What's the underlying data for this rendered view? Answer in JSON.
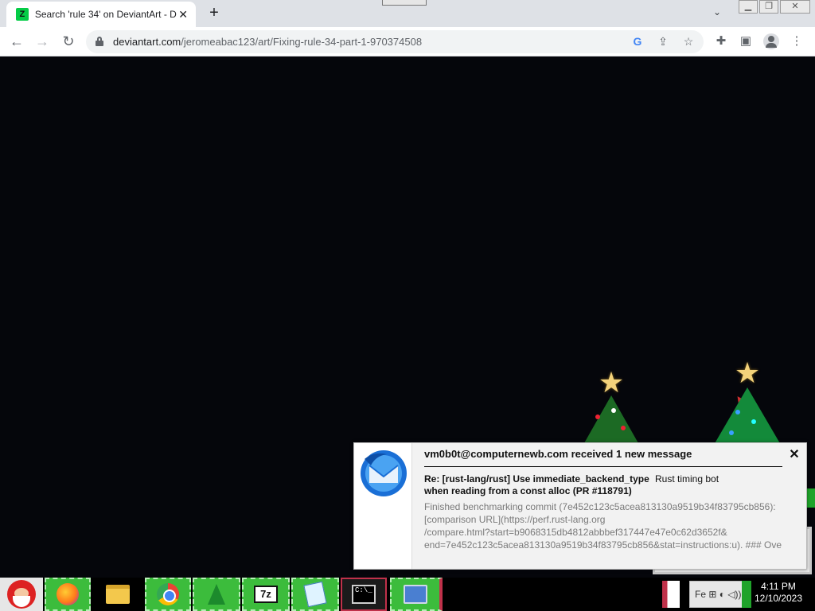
{
  "browser": {
    "tab_favicon_letter": "Z",
    "tab_title": "Search 'rule 34' on DeviantArt - D",
    "tab_close": "✕",
    "new_tab": "+",
    "tab_search": "⌄",
    "url_host": "deviantart.com",
    "url_path": "/jeromeabac123/art/Fixing-rule-34-part-1-970374508",
    "omnibox_icons": [
      "google-icon",
      "share-icon",
      "bookmark-star-icon"
    ],
    "toolbar_icons": [
      "extensions-icon",
      "side-panel-icon",
      "profile-icon",
      "menu-icon"
    ],
    "accent_color": "#dee1e6"
  },
  "notification": {
    "header": "vm0b0t@computernewb.com received 1 new message",
    "subject": "Re: [rust-lang/rust] Use immediate_backend_type when reading from a const alloc (PR #118791)",
    "sender": "Rust timing bot",
    "body_lines": [
      "Finished benchmarking commit (7e452c123c5acea813130a9519b34f83795cb856):",
      "[comparison URL](https://perf.rust-lang.org",
      "/compare.html?start=b9068315db4812abbbef317447e47e0c62d3652f&",
      "end=7e452c123c5acea813130a9519b34f83795cb856&stat=instructions:u). ### Ove"
    ],
    "close": "✕"
  },
  "taskbar": {
    "items": [
      "start-santa",
      "firefox",
      "file-explorer",
      "chrome",
      "christmas-tree",
      "7zip",
      "notepad",
      "command-prompt",
      "remote-desktop"
    ],
    "sevenzip_label": "7z",
    "cmd_label": "C:\\_",
    "tray_text": "Fe ⊞ ◐ ◁))",
    "time": "4:11 PM",
    "date": "12/10/2023"
  }
}
